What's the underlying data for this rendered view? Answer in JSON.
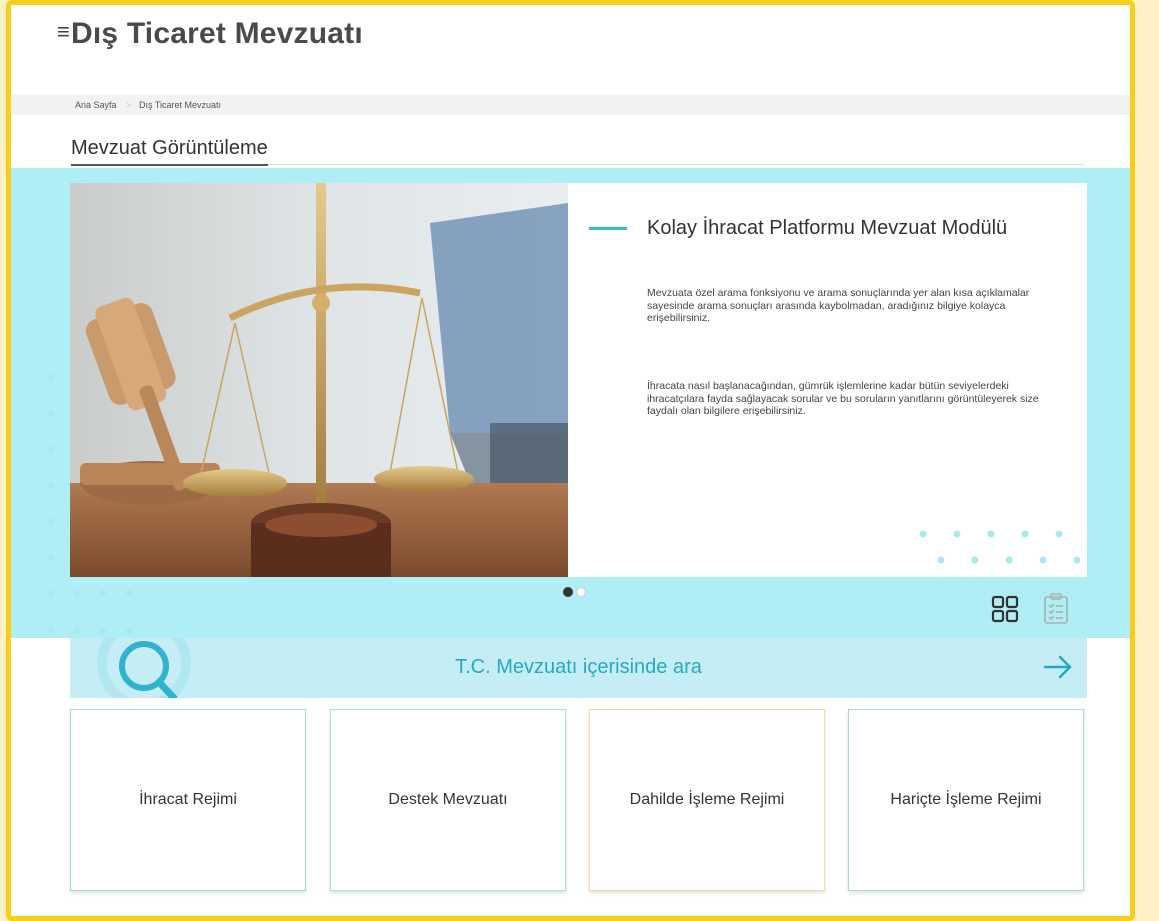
{
  "header": {
    "menu_icon": "hamburger-icon",
    "title": "Dış Ticaret Mevzuatı"
  },
  "breadcrumb": {
    "home": "Ana Sayfa",
    "separator": ">",
    "current": "Dış Ticaret Mevzuatı"
  },
  "page": {
    "title": "Mevzuat Görüntüleme"
  },
  "hero": {
    "title": "Kolay İhracat Platformu Mevzuat Modülü",
    "paragraph1": "Mevzuata özel arama fonksiyonu ve arama sonuçlarında yer alan kısa açıklamalar sayesinde arama sonuçları arasında kaybolmadan, aradığınız bilgiye kolayca erişebilirsiniz.",
    "paragraph2": "İhracata nasıl başlanacağından, gümrük işlemlerine kadar bütün seviyelerdeki ihracatçılara fayda sağlayacak sorular ve bu soruların yanıtlarını görüntüleyerek size faydalı olan bilgilere erişebilirsiniz.",
    "slide_count": 2,
    "active_slide": 1
  },
  "view_toggle": {
    "grid_icon": "grid-view-icon",
    "list_icon": "checklist-view-icon"
  },
  "search": {
    "label": "T.C. Mevzuatı içerisinde ara",
    "icon": "magnifier-icon",
    "arrow_icon": "arrow-right-icon"
  },
  "tiles": [
    {
      "label": "İhracat Rejimi",
      "border": "#a6e0cb"
    },
    {
      "label": "Destek Mevzuatı",
      "border": "#a8e3e8"
    },
    {
      "label": "Dahilde İşleme Rejimi",
      "border": "#f7d9a4"
    },
    {
      "label": "Hariçte İşleme Rejimi",
      "border": "#a6e0cb"
    }
  ],
  "colors": {
    "accent": "#33c1cf",
    "band": "#b0eef5",
    "frame": "#f7cf1a"
  }
}
